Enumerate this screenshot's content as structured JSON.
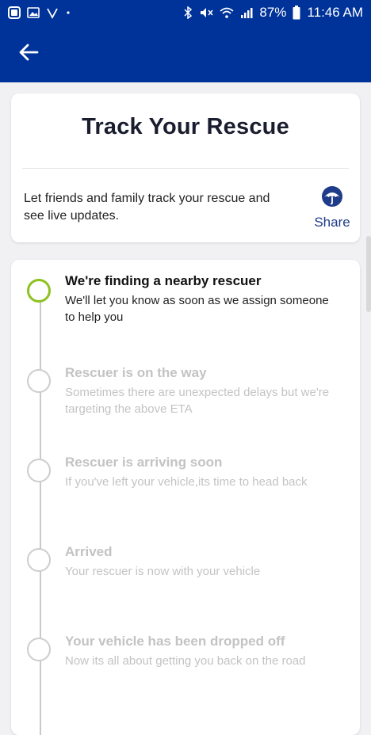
{
  "status_bar": {
    "battery": "87%",
    "time": "11:46 AM"
  },
  "header": {
    "back_icon": "arrow-left-icon",
    "color": "#003399"
  },
  "track_card": {
    "title": "Track Your Rescue",
    "share_description": "Let friends and family track your rescue and see live updates.",
    "share_label": "Share",
    "share_icon": "umbrella-logo-icon"
  },
  "steps": [
    {
      "title": "We're finding a nearby rescuer",
      "description": "We'll let you know as soon as we assign someone to help you",
      "active": true
    },
    {
      "title": "Rescuer is on the way",
      "description": "Sometimes there are unexpected delays but we're targeting the above ETA",
      "active": false
    },
    {
      "title": "Rescuer is arriving soon",
      "description": "If you've left your vehicle,its time to head back",
      "active": false
    },
    {
      "title": "Arrived",
      "description": "Your rescuer is now with your vehicle",
      "active": false
    },
    {
      "title": "Your vehicle has been dropped off",
      "description": "Now its all about getting you back on the road",
      "active": false
    }
  ],
  "colors": {
    "active_circle": "#8dc21f",
    "inactive_text": "#c3c3c3",
    "share_blue": "#1f3c8a"
  }
}
